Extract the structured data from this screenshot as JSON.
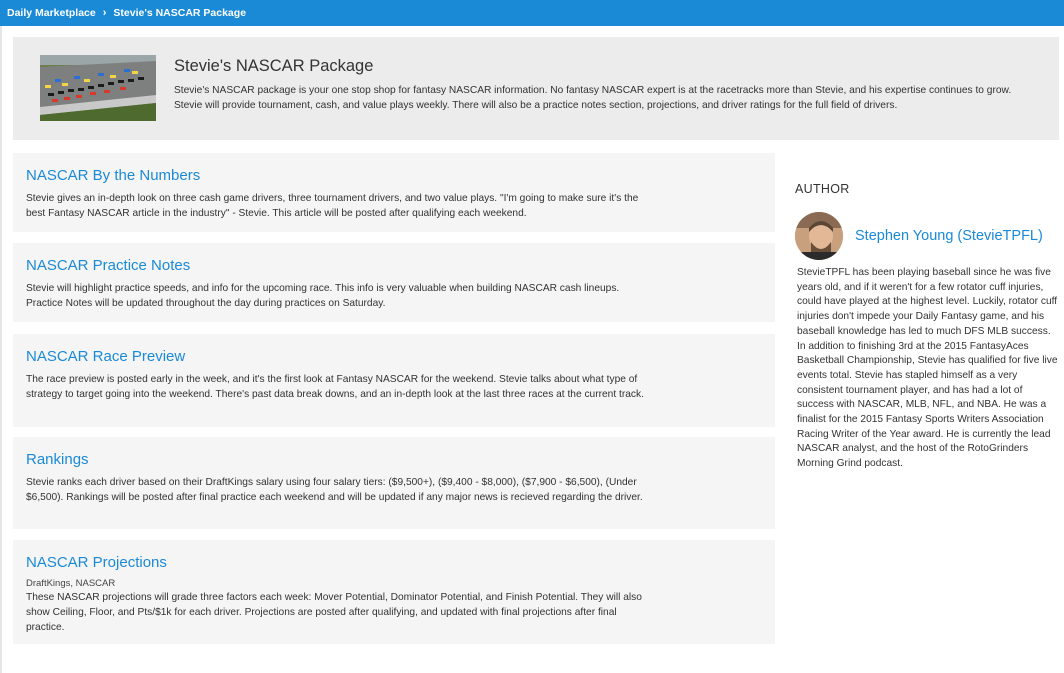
{
  "breadcrumb": {
    "parent": "Daily Marketplace",
    "separator": "›",
    "current": "Stevie's NASCAR Package"
  },
  "package": {
    "title": "Stevie's NASCAR Package",
    "description": "Stevie's NASCAR package is your one stop shop for fantasy NASCAR information. No fantasy NASCAR expert is at the racetracks more than Stevie, and his expertise continues to grow. Stevie will provide tournament, cash, and value plays weekly. There will also be a practice notes section, projections, and driver ratings for the full field of drivers.",
    "image_icon": "race-track-photo"
  },
  "items": [
    {
      "title": "NASCAR By the Numbers",
      "meta": "",
      "description": "Stevie gives an in-depth look on three cash game drivers, three tournament drivers, and two value plays. \"I'm going to make sure it's the best Fantasy NASCAR article in the industry\" - Stevie. This article will be posted after qualifying each weekend."
    },
    {
      "title": "NASCAR Practice Notes",
      "meta": "",
      "description": "Stevie will highlight practice speeds, and info for the upcoming race. This info is very valuable when building NASCAR cash lineups. Practice Notes will be updated throughout the day during practices on Saturday."
    },
    {
      "title": "NASCAR Race Preview",
      "meta": "",
      "description": "The race preview is posted early in the week, and it's the first look at Fantasy NASCAR for the weekend. Stevie talks about what type of strategy to target going into the weekend. There's past data break downs, and an in-depth look at the last three races at the current track."
    },
    {
      "title": "Rankings",
      "meta": "",
      "description": "Stevie ranks each driver based on their DraftKings salary using four salary tiers: ($9,500+), ($9,400 - $8,000), ($7,900 - $6,500), (Under $6,500). Rankings will be posted after final practice each weekend and will be updated if any major news is recieved regarding the driver."
    },
    {
      "title": "NASCAR Projections",
      "meta": "DraftKings, NASCAR",
      "description": "These NASCAR projections will grade three factors each week: Mover Potential, Dominator Potential, and Finish Potential. They will also show Ceiling, Floor, and Pts/$1k for each driver. Projections are posted after qualifying, and updated with final projections after final practice."
    }
  ],
  "author": {
    "heading": "AUTHOR",
    "name": "Stephen Young (StevieTPFL)",
    "avatar_icon": "author-avatar",
    "bio": "StevieTPFL has been playing baseball since he was five years old, and if it weren't for a few rotator cuff injuries, could have played at the highest level. Luckily, rotator cuff injuries don't impede your Daily Fantasy game, and his baseball knowledge has led to much DFS MLB success. In addition to finishing 3rd at the 2015 FantasyAces Basketball Championship, Stevie has qualified for five live events total. Stevie has stapled himself as a very consistent tournament player, and has had a lot of success with NASCAR, MLB, NFL, and NBA. He was a finalist for the 2015 Fantasy Sports Writers Association Racing Writer of the Year award. He is currently the lead NASCAR analyst, and the host of the RotoGrinders Morning Grind podcast."
  },
  "colors": {
    "accent": "#1a8ad6",
    "card_bg": "#f5f5f5",
    "hero_bg": "#ececec"
  }
}
